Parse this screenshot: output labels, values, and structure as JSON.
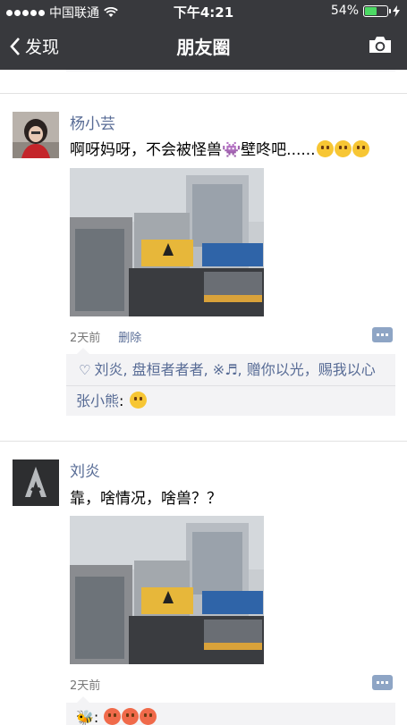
{
  "status_bar": {
    "carrier": "中国联通",
    "time": "下午4:21",
    "battery": "54%",
    "battery_level": 0.54
  },
  "nav": {
    "back_label": "发现",
    "title": "朋友圈",
    "camera_icon": "camera-icon"
  },
  "posts": [
    {
      "author": "杨小芸",
      "text": "啊呀妈呀，不会被怪兽👾壁咚吧......",
      "time": "2天前",
      "delete_label": "删除",
      "likes": "刘炎, 盘桓者者者, ※♬, 赠你以光，赐我以心",
      "comments": [
        {
          "name": "张小熊",
          "sep": ": "
        }
      ]
    },
    {
      "author": "刘炎",
      "text": "靠，啥情况，啥兽？？",
      "time": "2天前",
      "comments": [
        {
          "name": "🐝",
          "sep": ": "
        }
      ]
    }
  ],
  "colors": {
    "navbar": "#38393d",
    "link": "#576b95",
    "interaction_bg": "#f3f3f5",
    "battery": "#4cd964"
  }
}
